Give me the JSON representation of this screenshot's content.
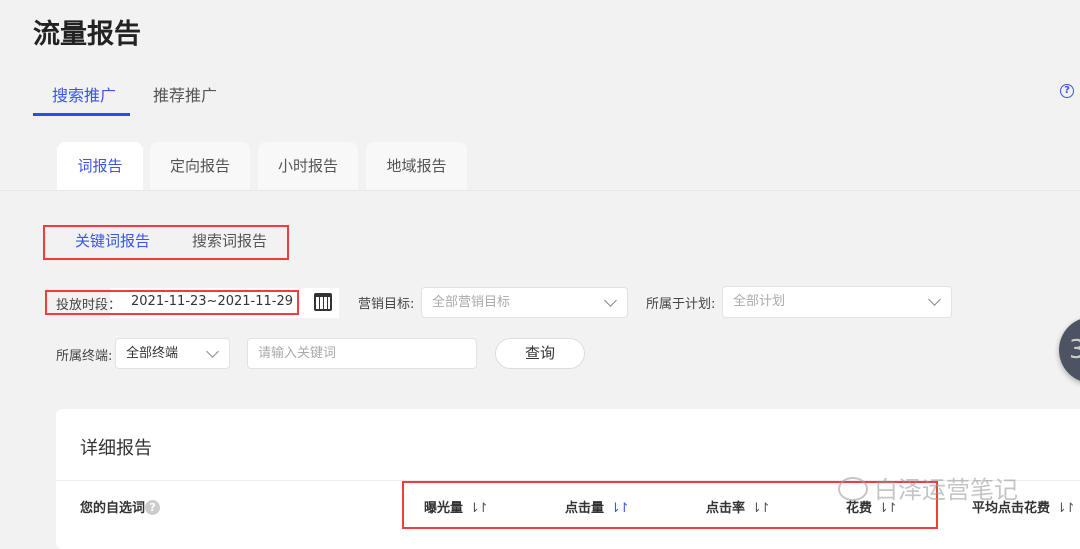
{
  "page_title": "流量报告",
  "top_tabs": [
    {
      "label": "搜索推广",
      "active": true
    },
    {
      "label": "推荐推广",
      "active": false
    }
  ],
  "sub_tabs": [
    "词报告",
    "定向报告",
    "小时报告",
    "地域报告"
  ],
  "report_tabs": [
    "关键词报告",
    "搜索词报告"
  ],
  "filters": {
    "period_label": "投放时段：",
    "period_value": "2021-11-23~2021-11-29",
    "goal_label": "营销目标:",
    "goal_value": "全部营销目标",
    "plan_label": "所属于计划:",
    "plan_value": "全部计划",
    "terminal_label": "所属终端:",
    "terminal_value": "全部终端",
    "keyword_placeholder": "请输入关键词",
    "query_button": "查询"
  },
  "float_button": "3",
  "report": {
    "title": "详细报告",
    "columns": [
      "您的自选词",
      "曝光量",
      "点击量",
      "点击率",
      "花费",
      "平均点击花费"
    ],
    "sort_glyph": "⇂↾"
  },
  "watermark": "白泽运营笔记",
  "colors": {
    "accent": "#3a55e8",
    "highlight": "#f03c3c",
    "background": "#f2f2f2"
  }
}
